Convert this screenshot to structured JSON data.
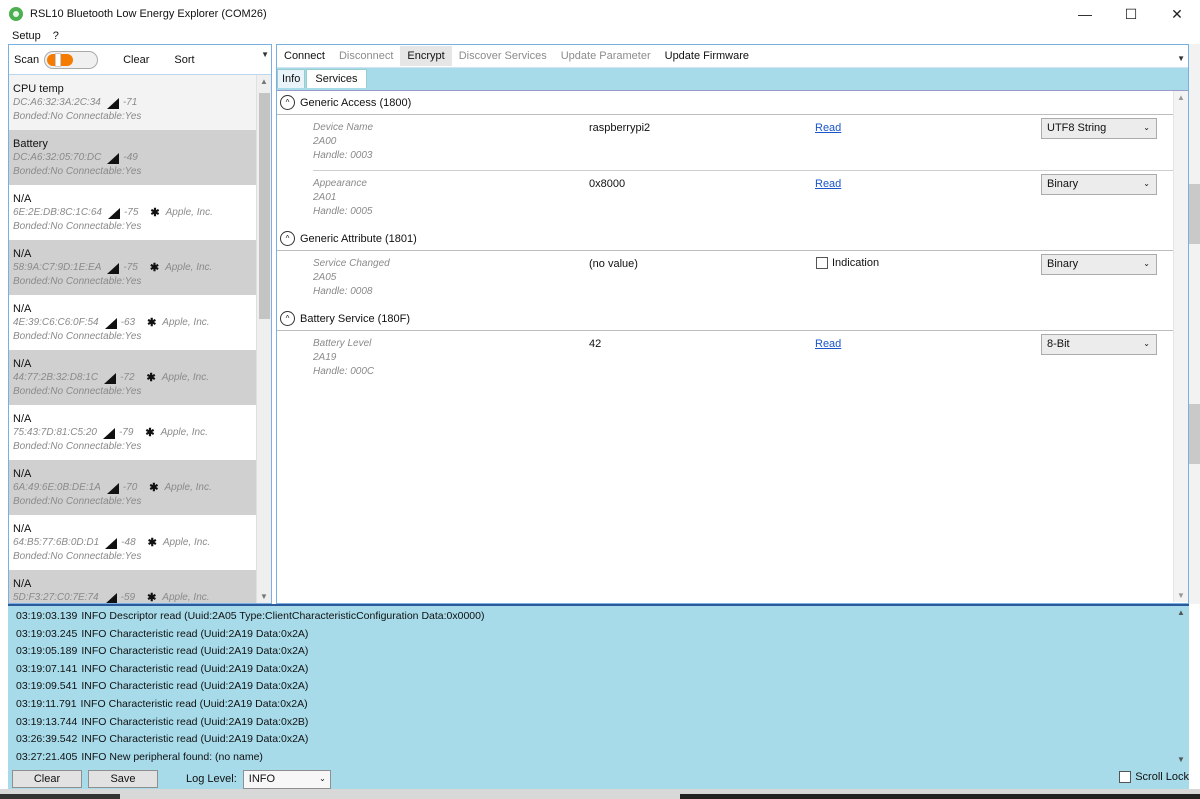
{
  "window": {
    "title": "RSL10 Bluetooth Low Energy Explorer (COM26)",
    "minimize": "—",
    "maximize": "☐",
    "close": "✕"
  },
  "menu": [
    "Setup",
    "?"
  ],
  "left_toolbar": {
    "scan_label": "Scan",
    "scan_on": true,
    "clear_label": "Clear",
    "sort_label": "Sort"
  },
  "devices": [
    {
      "name": "CPU temp",
      "address": "DC:A6:32:3A:2C:34",
      "rssi": "-71",
      "vendor": "",
      "bonded": "Bonded:No Connectable:Yes"
    },
    {
      "name": "Battery",
      "address": "DC:A6:32:05:70:DC",
      "rssi": "-49",
      "vendor": "",
      "bonded": "Bonded:No Connectable:Yes"
    },
    {
      "name": "N/A",
      "address": "6E:2E:DB:8C:1C:64",
      "rssi": "-75",
      "vendor": "Apple, Inc.",
      "bonded": "Bonded:No Connectable:Yes"
    },
    {
      "name": "N/A",
      "address": "58:9A:C7:9D:1E:EA",
      "rssi": "-75",
      "vendor": "Apple, Inc.",
      "bonded": "Bonded:No Connectable:Yes"
    },
    {
      "name": "N/A",
      "address": "4E:39:C6:C6:0F:54",
      "rssi": "-63",
      "vendor": "Apple, Inc.",
      "bonded": "Bonded:No Connectable:Yes"
    },
    {
      "name": "N/A",
      "address": "44:77:2B:32:D8:1C",
      "rssi": "-72",
      "vendor": "Apple, Inc.",
      "bonded": "Bonded:No Connectable:Yes"
    },
    {
      "name": "N/A",
      "address": "75:43:7D:81:C5:20",
      "rssi": "-79",
      "vendor": "Apple, Inc.",
      "bonded": "Bonded:No Connectable:Yes"
    },
    {
      "name": "N/A",
      "address": "6A:49:6E:0B:DE:1A",
      "rssi": "-70",
      "vendor": "Apple, Inc.",
      "bonded": "Bonded:No Connectable:Yes"
    },
    {
      "name": "N/A",
      "address": "64:B5:77:6B:0D:D1",
      "rssi": "-48",
      "vendor": "Apple, Inc.",
      "bonded": "Bonded:No Connectable:Yes"
    },
    {
      "name": "N/A",
      "address": "5D:F3:27:C0:7E:74",
      "rssi": "-59",
      "vendor": "Apple, Inc.",
      "bonded": ""
    }
  ],
  "actions": {
    "connect": "Connect",
    "disconnect": "Disconnect",
    "encrypt": "Encrypt",
    "discover_services": "Discover Services",
    "update_parameter": "Update Parameter",
    "update_firmware": "Update Firmware"
  },
  "tabs": {
    "info": "Info",
    "services": "Services",
    "selected": "Services"
  },
  "services": [
    {
      "title": "Generic Access (1800)",
      "characteristics": [
        {
          "name": "Device Name",
          "uuid": "2A00",
          "handle": "Handle: 0003",
          "value": "raspberrypi2",
          "action": "Read",
          "format": "UTF8 String"
        },
        {
          "name": "Appearance",
          "uuid": "2A01",
          "handle": "Handle: 0005",
          "value": "0x8000",
          "action": "Read",
          "format": "Binary"
        }
      ]
    },
    {
      "title": "Generic Attribute (1801)",
      "characteristics": [
        {
          "name": "Service Changed",
          "uuid": "2A05",
          "handle": "Handle: 0008",
          "value": "(no value)",
          "checkbox_label": "Indication",
          "checked": false,
          "format": "Binary"
        }
      ]
    },
    {
      "title": "Battery Service (180F)",
      "characteristics": [
        {
          "name": "Battery Level",
          "uuid": "2A19",
          "handle": "Handle: 000C",
          "value": "42",
          "action": "Read",
          "format": "8-Bit"
        }
      ]
    }
  ],
  "log": [
    {
      "time": "03:19:03.139",
      "level": "INFO",
      "message": "Descriptor read (Uuid:2A05 Type:ClientCharacteristicConfiguration Data:0x0000)"
    },
    {
      "time": "03:19:03.245",
      "level": "INFO",
      "message": "Characteristic read (Uuid:2A19 Data:0x2A)"
    },
    {
      "time": "03:19:05.189",
      "level": "INFO",
      "message": "Characteristic read (Uuid:2A19 Data:0x2A)"
    },
    {
      "time": "03:19:07.141",
      "level": "INFO",
      "message": "Characteristic read (Uuid:2A19 Data:0x2A)"
    },
    {
      "time": "03:19:09.541",
      "level": "INFO",
      "message": "Characteristic read (Uuid:2A19 Data:0x2A)"
    },
    {
      "time": "03:19:11.791",
      "level": "INFO",
      "message": "Characteristic read (Uuid:2A19 Data:0x2A)"
    },
    {
      "time": "03:19:13.744",
      "level": "INFO",
      "message": "Characteristic read (Uuid:2A19 Data:0x2B)"
    },
    {
      "time": "03:26:39.542",
      "level": "INFO",
      "message": "Characteristic read (Uuid:2A19 Data:0x2A)"
    },
    {
      "time": "03:27:21.405",
      "level": "INFO",
      "message": "New peripheral found: (no name)"
    }
  ],
  "log_footer": {
    "clear_label": "Clear",
    "save_label": "Save",
    "log_level_label": "Log Level:",
    "log_level_value": "INFO",
    "scroll_lock_label": "Scroll Lock",
    "scroll_lock_checked": false
  },
  "colors": {
    "accent_blue": "#a7dbea",
    "scan_orange": "#f57c00",
    "link_blue": "#1a56c9",
    "row_alt": "#d0d0d0"
  }
}
